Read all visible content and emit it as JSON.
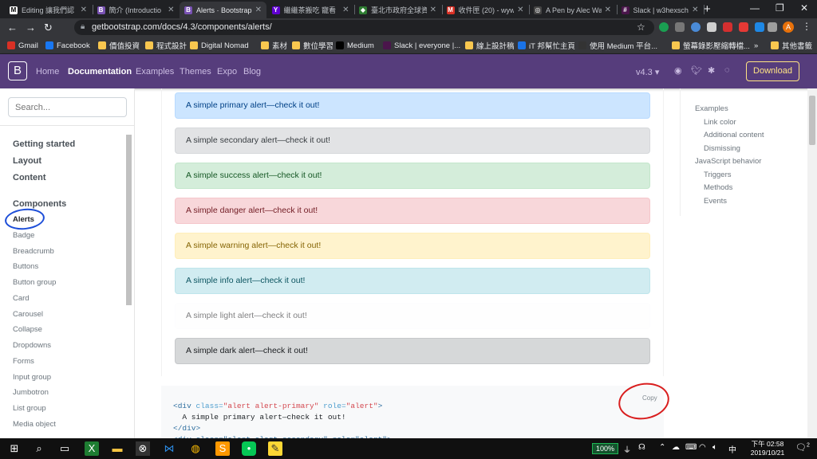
{
  "browser": {
    "tabs": [
      {
        "title": "Editing 讓我們認",
        "icon_text": "M",
        "icon_color": "#ffffff"
      },
      {
        "title": "簡介 (Introductio",
        "icon_text": "B",
        "icon_color": "#7952b3"
      },
      {
        "title": "Alerts · Bootstrap",
        "icon_text": "B",
        "icon_color": "#7952b3"
      },
      {
        "title": "繼繼茶搬吃 寵看",
        "icon_text": "Y",
        "icon_color": "#6001d2"
      },
      {
        "title": "臺北市政府全球資",
        "icon_text": "◆",
        "icon_color": "#2e7d32"
      },
      {
        "title": "收件匣 (20) - wyw",
        "icon_text": "M",
        "icon_color": "#d93025"
      },
      {
        "title": "A Pen by Alec Wa",
        "icon_text": "◎",
        "icon_color": "#444444"
      },
      {
        "title": "Slack | w3hexsch",
        "icon_text": "#",
        "icon_color": "#4a154b"
      }
    ],
    "url": "getbootstrap.com/docs/4.3/components/alerts/",
    "avatar_letter": "A",
    "bookmarks": [
      {
        "label": "Gmail",
        "type": "mail"
      },
      {
        "label": "Facebook",
        "type": "fb"
      },
      {
        "label": "價值投資",
        "type": "folder"
      },
      {
        "label": "程式設計",
        "type": "folder"
      },
      {
        "label": "Digital Nomad",
        "type": "folder"
      },
      {
        "label": "素材",
        "type": "folder"
      },
      {
        "label": "數位學習",
        "type": "folder"
      },
      {
        "label": "Medium",
        "type": "medium"
      },
      {
        "label": "Slack | everyone |...",
        "type": "slack"
      },
      {
        "label": "線上設計稿",
        "type": "folder"
      },
      {
        "label": "iT 邦幫忙主頁",
        "type": "it"
      },
      {
        "label": "使用 Medium 平台...",
        "type": "medium2"
      },
      {
        "label": "螢幕錄影壓縮轉檔...",
        "type": "folder"
      },
      {
        "label": "»",
        "type": "more"
      },
      {
        "label": "其他書籤",
        "type": "folder"
      }
    ]
  },
  "navbar": {
    "brand": "B",
    "links": [
      "Home",
      "Documentation",
      "Examples",
      "Themes",
      "Expo",
      "Blog"
    ],
    "active": "Documentation",
    "version": "v4.3 ▾",
    "download": "Download"
  },
  "sidebar": {
    "search_placeholder": "Search...",
    "sections": [
      "Getting started",
      "Layout",
      "Content",
      "Components"
    ],
    "components": [
      "Alerts",
      "Badge",
      "Breadcrumb",
      "Buttons",
      "Button group",
      "Card",
      "Carousel",
      "Collapse",
      "Dropdowns",
      "Forms",
      "Input group",
      "Jumbotron",
      "List group",
      "Media object"
    ],
    "current": "Alerts"
  },
  "alerts": [
    {
      "variant": "primary",
      "text": "A simple primary alert—check it out!",
      "bg": "#cce5ff",
      "border": "#b8daff",
      "color": "#004085"
    },
    {
      "variant": "secondary",
      "text": "A simple secondary alert—check it out!",
      "bg": "#e2e3e5",
      "border": "#d6d8db",
      "color": "#383d41"
    },
    {
      "variant": "success",
      "text": "A simple success alert—check it out!",
      "bg": "#d4edda",
      "border": "#c3e6cb",
      "color": "#155724"
    },
    {
      "variant": "danger",
      "text": "A simple danger alert—check it out!",
      "bg": "#f8d7da",
      "border": "#f5c6cb",
      "color": "#721c24"
    },
    {
      "variant": "warning",
      "text": "A simple warning alert—check it out!",
      "bg": "#fff3cd",
      "border": "#ffeeba",
      "color": "#856404"
    },
    {
      "variant": "info",
      "text": "A simple info alert—check it out!",
      "bg": "#d1ecf1",
      "border": "#bee5eb",
      "color": "#0c5460"
    },
    {
      "variant": "light",
      "text": "A simple light alert—check it out!",
      "bg": "#fefefe",
      "border": "#fdfdfe",
      "color": "#818182"
    },
    {
      "variant": "dark",
      "text": "A simple dark alert—check it out!",
      "bg": "#d6d8d9",
      "border": "#c6c8ca",
      "color": "#1b1e21"
    }
  ],
  "code": {
    "copy_label": "Copy",
    "line1_open": "<div",
    "line1_attr1": " class=",
    "line1_val1": "\"alert alert-primary\"",
    "line1_attr2": " role=",
    "line1_val2": "\"alert\"",
    "line1_close": ">",
    "line2": "  A simple primary alert—check it out!",
    "line3": "</div>",
    "line4_partial": "<div class=\"alert alert-secondary\" role=\"alert\">"
  },
  "toc": [
    {
      "label": "Examples",
      "level": 1
    },
    {
      "label": "Link color",
      "level": 2
    },
    {
      "label": "Additional content",
      "level": 2
    },
    {
      "label": "Dismissing",
      "level": 2
    },
    {
      "label": "JavaScript behavior",
      "level": 1
    },
    {
      "label": "Triggers",
      "level": 2
    },
    {
      "label": "Methods",
      "level": 2
    },
    {
      "label": "Events",
      "level": 2
    }
  ],
  "taskbar": {
    "battery": "100%",
    "ime": "中",
    "time": "下午 02:58",
    "date": "2019/10/21",
    "notifications": "2"
  }
}
